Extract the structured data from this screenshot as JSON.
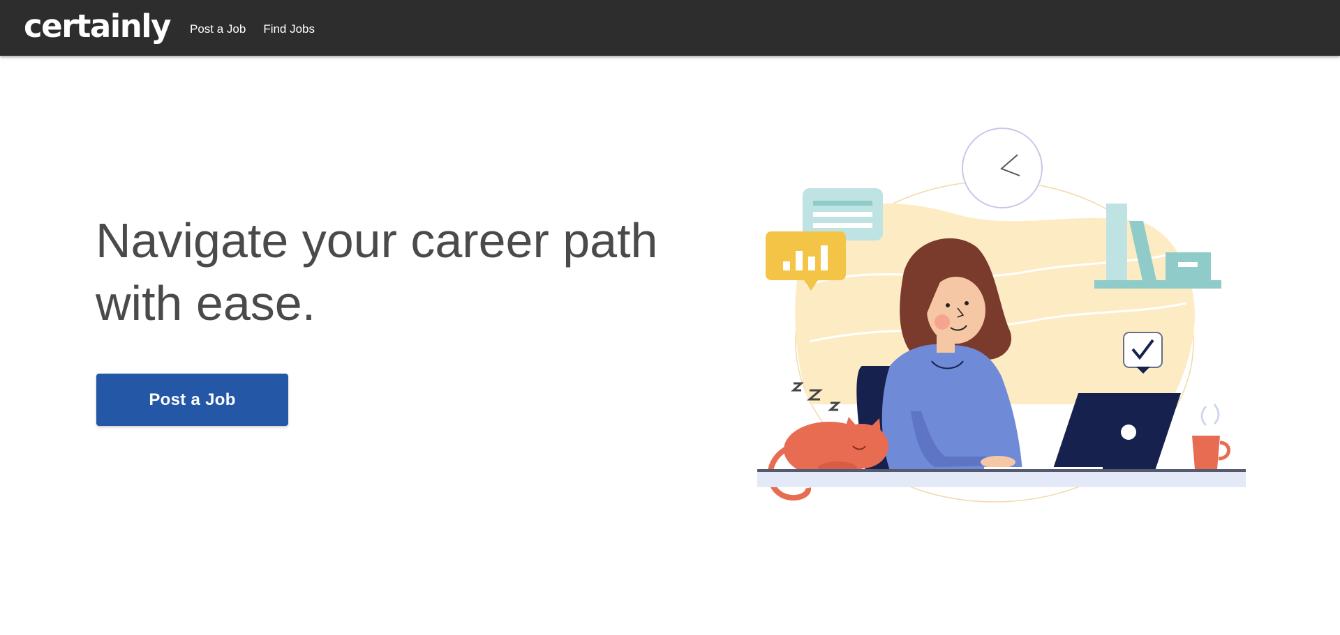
{
  "navbar": {
    "brand": "certainly",
    "links": [
      {
        "label": "Post a Job"
      },
      {
        "label": "Find Jobs"
      }
    ]
  },
  "hero": {
    "headline": "Navigate your career path with ease.",
    "cta_label": "Post a Job"
  },
  "colors": {
    "navbar_bg": "#2d2d2d",
    "cta_bg": "#2557a7",
    "headline_text": "#4a4a4a",
    "blob": "#fdebc4",
    "shirt": "#6f8ad6",
    "hair": "#7a3a2c",
    "cat": "#e86c52",
    "laptop": "#16214d",
    "bubble_yellow": "#f4c447",
    "bubble_teal": "#bfe3e3",
    "shelf_teal": "#8fcbc8",
    "desk_top": "#e4e9f8"
  },
  "icons": {
    "chart": "bar-chart-icon",
    "check": "check-icon",
    "clock": "clock-icon"
  }
}
